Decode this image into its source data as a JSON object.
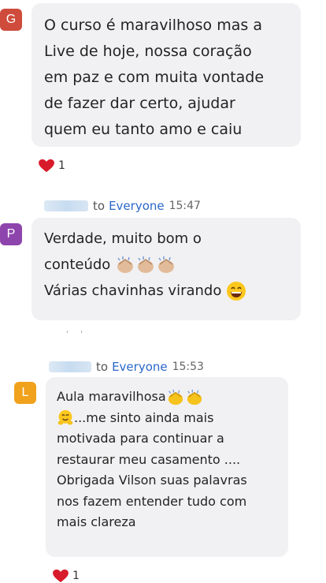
{
  "colors": {
    "avatar_g": "#cf4b3c",
    "avatar_p": "#8e44ad",
    "avatar_l": "#f0a21c",
    "bubble_bg": "#f1f1f3",
    "link_blue": "#2a67c9",
    "heart_red": "#d81b2a"
  },
  "messages": [
    {
      "avatar_initial": "G",
      "lines": [
        "O curso é maravilhoso mas a",
        "Live de hoje, nossa coração",
        "em paz e com muita vontade",
        "de fazer dar certo, ajudar",
        "quem eu tanto amo e caiu"
      ],
      "reaction": {
        "icon": "heart-icon",
        "count": "1"
      }
    },
    {
      "avatar_initial": "P",
      "to_label": "to",
      "recipient": "Everyone",
      "time": "15:47",
      "lines": [
        "Verdade, muito bom o",
        "conteúdo",
        "Várias chavinhas virando"
      ],
      "emoji": [
        "clapping-hands-icon",
        "grinning-face-icon"
      ]
    },
    {
      "avatar_initial": "L",
      "to_label": "to",
      "recipient": "Everyone",
      "time": "15:53",
      "lines": [
        "Aula maravilhosa",
        "...me sinto ainda mais",
        "motivada para continuar a",
        "restaurar meu casamento ....",
        "Obrigada Vilson suas palavras",
        "nos fazem entender tudo com",
        "mais clareza"
      ],
      "emoji": [
        "clapping-hands-icon",
        "hugging-face-icon"
      ],
      "reaction": {
        "icon": "heart-icon",
        "count": "1"
      }
    }
  ]
}
